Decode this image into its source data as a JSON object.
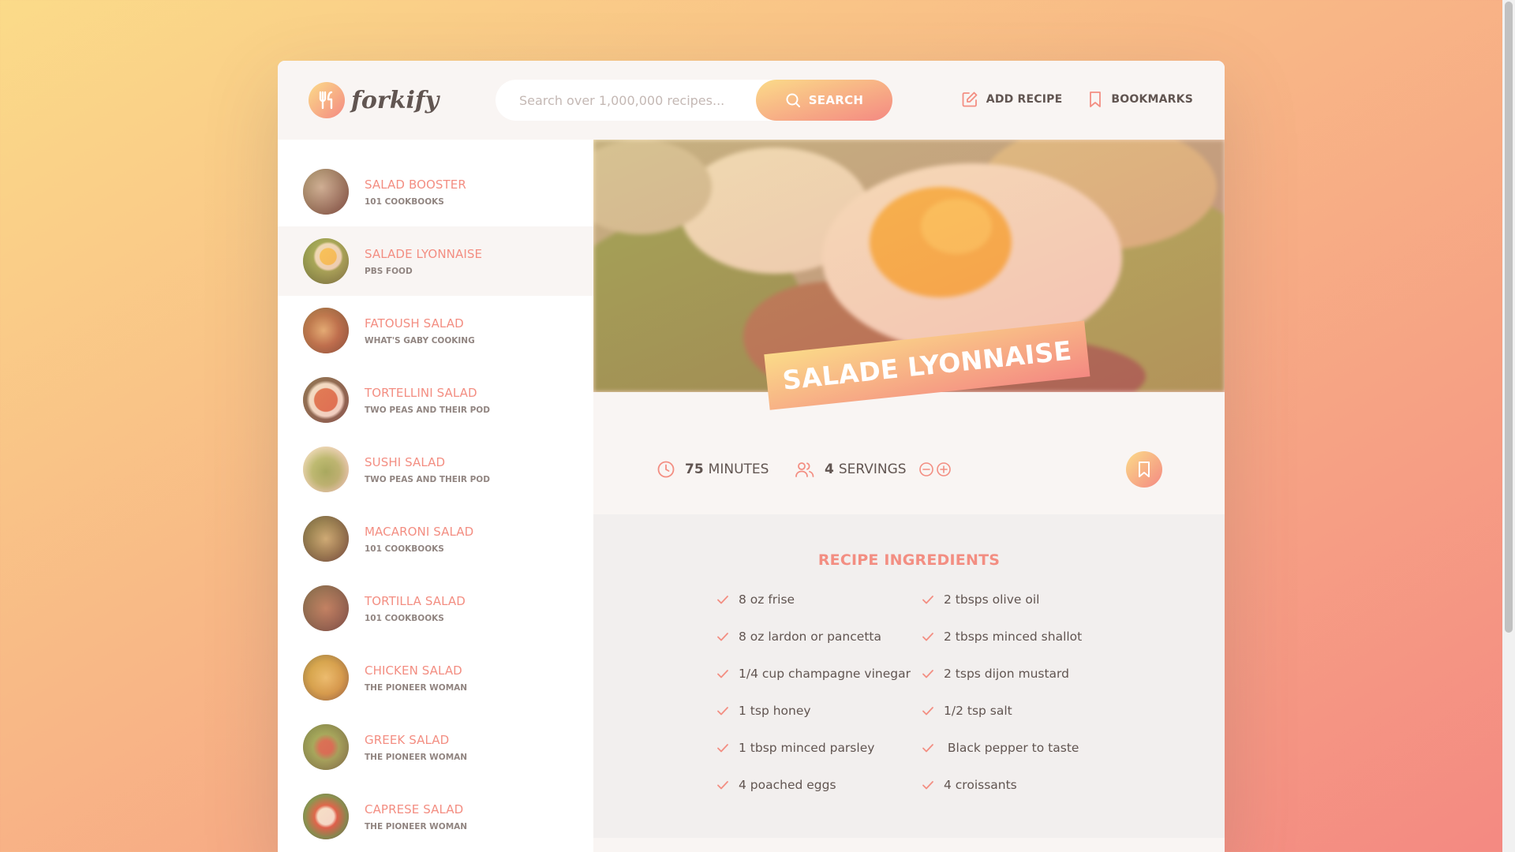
{
  "brand": {
    "name": "forkify"
  },
  "search": {
    "placeholder": "Search over 1,000,000 recipes...",
    "button_label": "SEARCH"
  },
  "nav": {
    "add_recipe": "ADD RECIPE",
    "bookmarks": "BOOKMARKS"
  },
  "colors": {
    "accent": "#f38e82",
    "gradient_start": "#fbdb89",
    "gradient_end": "#f48982",
    "text": "#615551"
  },
  "results": [
    {
      "title": "SALAD BOOSTER",
      "publisher": "101 COOKBOOKS",
      "active": false
    },
    {
      "title": "SALADE LYONNAISE",
      "publisher": "PBS FOOD",
      "active": true
    },
    {
      "title": "FATOUSH SALAD",
      "publisher": "WHAT'S GABY COOKING",
      "active": false
    },
    {
      "title": "TORTELLINI SALAD",
      "publisher": "TWO PEAS AND THEIR POD",
      "active": false
    },
    {
      "title": "SUSHI SALAD",
      "publisher": "TWO PEAS AND THEIR POD",
      "active": false
    },
    {
      "title": "MACARONI SALAD",
      "publisher": "101 COOKBOOKS",
      "active": false
    },
    {
      "title": "TORTILLA SALAD",
      "publisher": "101 COOKBOOKS",
      "active": false
    },
    {
      "title": "CHICKEN SALAD",
      "publisher": "THE PIONEER WOMAN",
      "active": false
    },
    {
      "title": "GREEK SALAD",
      "publisher": "THE PIONEER WOMAN",
      "active": false
    },
    {
      "title": "CAPRESE SALAD",
      "publisher": "THE PIONEER WOMAN",
      "active": false
    }
  ],
  "recipe": {
    "title": "SALADE LYONNAISE",
    "cooking_time": "75",
    "cooking_time_unit": "MINUTES",
    "servings": "4",
    "servings_unit": "SERVINGS",
    "ingredients_heading": "RECIPE INGREDIENTS",
    "ingredients": [
      "8 oz frise",
      "8 oz lardon or pancetta",
      "1/4 cup champagne vinegar",
      "1 tsp honey",
      "1 tbsp minced parsley",
      "4 poached eggs",
      "2 tbsps olive oil",
      "2 tbsps minced shallot",
      "2 tsps dijon mustard",
      "1/2 tsp salt",
      " Black pepper to taste",
      "4 croissants"
    ]
  }
}
